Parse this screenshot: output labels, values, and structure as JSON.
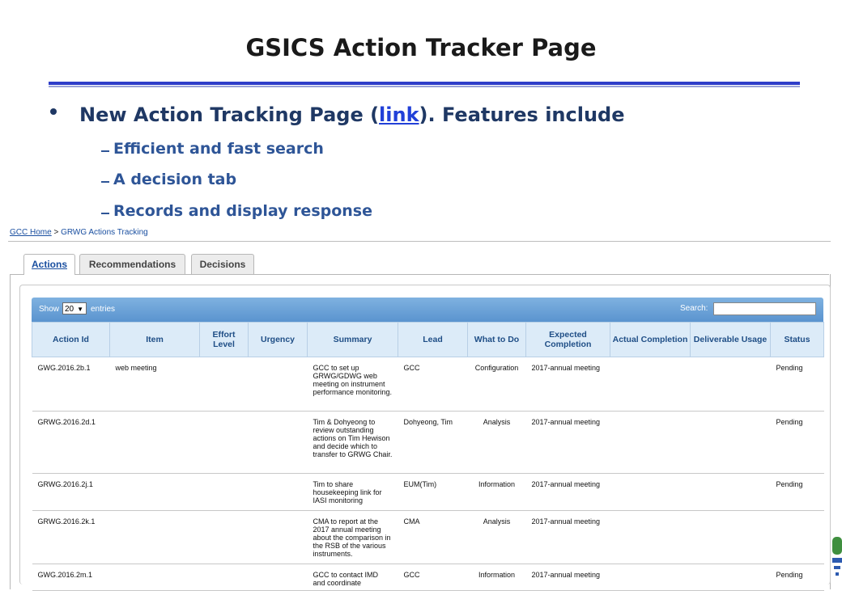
{
  "slide": {
    "title": "GSICS Action Tracker Page",
    "bullet_prefix": "New Action Tracking Page (",
    "bullet_link": "link",
    "bullet_suffix": "). Features include",
    "sub_bullets": [
      "Efficient and fast search",
      "A decision tab",
      "Records  and display response"
    ]
  },
  "breadcrumb": {
    "home": "GCC Home",
    "separator": " > ",
    "current": "GRWG Actions Tracking"
  },
  "tabs": [
    {
      "label": "Actions",
      "active": true
    },
    {
      "label": "Recommendations",
      "active": false
    },
    {
      "label": "Decisions",
      "active": false
    }
  ],
  "toolbar": {
    "show_label": "Show",
    "entries_value": "20",
    "entries_label": "entries",
    "search_label": "Search:",
    "search_value": ""
  },
  "table": {
    "columns": [
      "Action Id",
      "Item",
      "Effort Level",
      "Urgency",
      "Summary",
      "Lead",
      "What to Do",
      "Expected Completion",
      "Actual Completion",
      "Deliverable Usage",
      "Status"
    ],
    "rows": [
      [
        "GWG.2016.2b.1",
        "web meeting",
        "",
        "",
        "GCC to set up GRWG/GDWG web meeting on instrument performance monitoring.",
        "GCC",
        "Configuration",
        "2017-annual meeting",
        "",
        "",
        "Pending"
      ],
      [
        "GRWG.2016.2d.1",
        "",
        "",
        "",
        "Tim & Dohyeong to review outstanding actions on Tim Hewison and decide which to transfer to GRWG Chair.",
        "Dohyeong, Tim",
        "Analysis",
        "2017-annual meeting",
        "",
        "",
        "Pending"
      ],
      [
        "GRWG.2016.2j.1",
        "",
        "",
        "",
        "Tim to share housekeeping link for IASI monitoring",
        "EUM(Tim)",
        "Information",
        "2017-annual meeting",
        "",
        "",
        "Pending"
      ],
      [
        "GRWG.2016.2k.1",
        "",
        "",
        "",
        "CMA to report at the 2017 annual meeting about the comparison in the RSB of the various instruments.",
        "CMA",
        "Analysis",
        "2017-annual meeting",
        "",
        "",
        ""
      ],
      [
        "GWG.2016.2m.1",
        "",
        "",
        "",
        "GCC to contact IMD and coordinate",
        "GCC",
        "Information",
        "2017-annual meeting",
        "",
        "",
        "Pending"
      ]
    ]
  },
  "colors": {
    "title_rule": "#2f3ec9",
    "bullet": "#1f3864",
    "sub_bullet": "#2e5597",
    "link": "#2140d8",
    "toolbar": "#6aa2d8",
    "header_bg": "#dcebf8"
  }
}
